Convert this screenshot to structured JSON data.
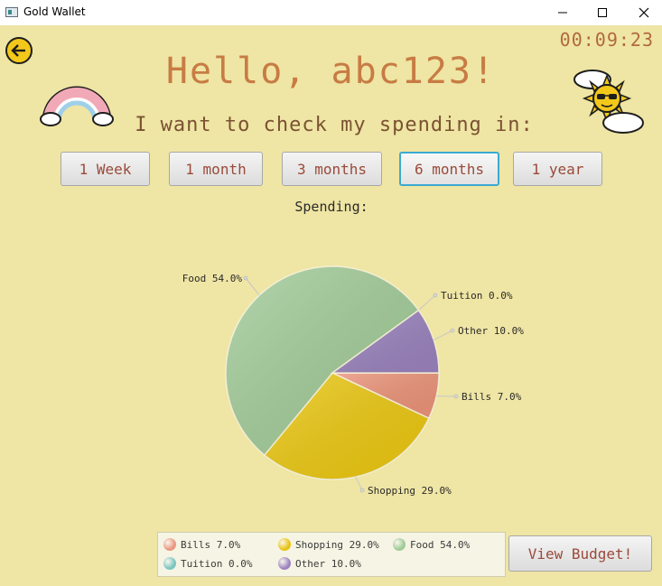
{
  "window": {
    "title": "Gold Wallet",
    "controls": {
      "minimize": "—",
      "maximize": "☐",
      "close": "✕"
    }
  },
  "header": {
    "timer": "00:09:23",
    "greeting": "Hello, abc123!",
    "question": "I want to check my spending in:"
  },
  "periods": [
    {
      "label": "1 Week",
      "selected": false
    },
    {
      "label": "1 month",
      "selected": false
    },
    {
      "label": "3 months",
      "selected": false
    },
    {
      "label": "6 months",
      "selected": true
    },
    {
      "label": "1 year",
      "selected": false
    }
  ],
  "chart_title": "Spending:",
  "chart_data": {
    "type": "pie",
    "title": "Spending:",
    "legend_placement": "bottom",
    "slices": [
      {
        "name": "Bills",
        "label": "Bills 7.0%",
        "value": 7.0,
        "color": "#ec9378"
      },
      {
        "name": "Shopping",
        "label": "Shopping 29.0%",
        "value": 29.0,
        "color": "#ecc810"
      },
      {
        "name": "Food",
        "label": "Food 54.0%",
        "value": 54.0,
        "color": "#a2cc98"
      },
      {
        "name": "Tuition",
        "label": "Tuition 0.0%",
        "value": 0.0,
        "color": "#79c6c1"
      },
      {
        "name": "Other",
        "label": "Other 10.0%",
        "value": 10.0,
        "color": "#9a82bd"
      }
    ]
  },
  "legend": [
    {
      "label": "Bills 7.0%",
      "color": "#e99781"
    },
    {
      "label": "Shopping 29.0%",
      "color": "#e9c212"
    },
    {
      "label": "Food 54.0%",
      "color": "#9fcb95"
    },
    {
      "label": "Tuition 0.0%",
      "color": "#7bc5c0"
    },
    {
      "label": "Other 10.0%",
      "color": "#9d82bf"
    }
  ],
  "actions": {
    "view_budget": "View Budget!"
  },
  "icons": {
    "back": "arrow-left-icon",
    "rainbow": "rainbow-icon",
    "weather": "sun-cloud-icon"
  }
}
